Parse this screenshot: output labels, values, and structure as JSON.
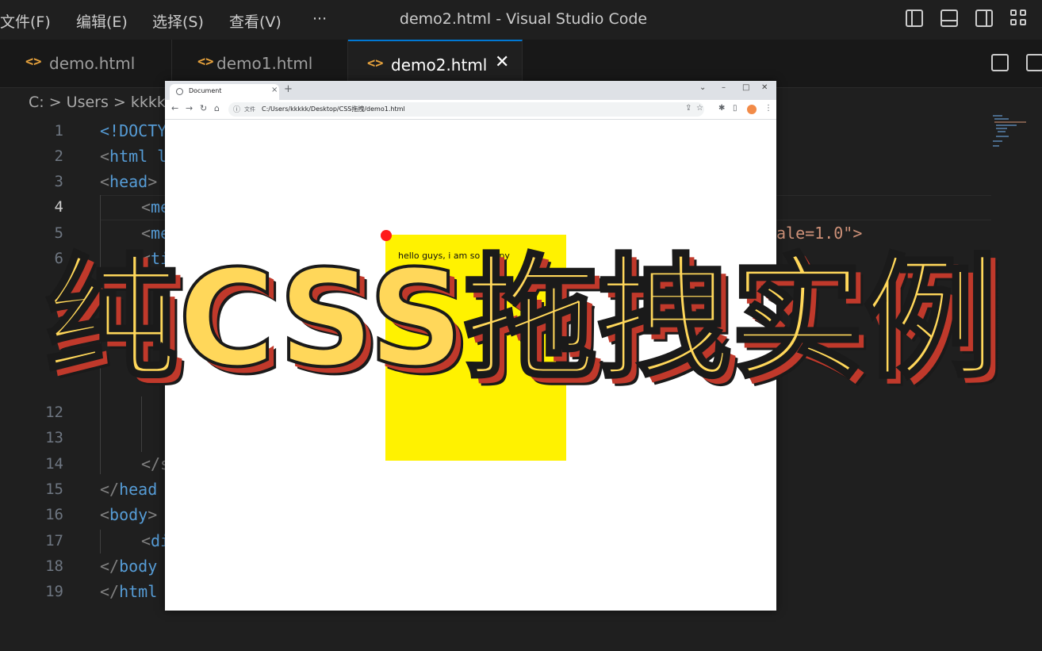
{
  "menu": [
    "文件(F)",
    "编辑(E)",
    "选择(S)",
    "查看(V)",
    "···"
  ],
  "window_title": "demo2.html - Visual Studio Code",
  "tabs": [
    {
      "icon": "<>",
      "label": "demo.html",
      "active": false
    },
    {
      "icon": "<>",
      "label": "demo1.html",
      "active": false
    },
    {
      "icon": "<>",
      "label": "demo2.html",
      "active": true,
      "close": "✕"
    }
  ],
  "breadcrumb": "C: > Users > kkkk",
  "line_numbers": [
    "1",
    "2",
    "3",
    "4",
    "5",
    "6",
    "12",
    "13",
    "14",
    "15",
    "16",
    "17",
    "18",
    "19"
  ],
  "code": {
    "l1": "<!DOCTY",
    "l2_tag": "html",
    "l2_rest": " l",
    "l3": "head",
    "l4": "me",
    "l5": "me",
    "l5_tail": "ale=1.0\">",
    "l6": "ti",
    "l14": "</s",
    "l15": "head",
    "l16": "body",
    "l17": "di",
    "l18": "body",
    "l19": "html"
  },
  "browser": {
    "tab_title": "Document",
    "tab_close": "×",
    "new_tab": "+",
    "scheme_label": "文件",
    "url": "C:/Users/kkkkk/Desktop/CSS拖拽/demo1.html",
    "box_text": "hello guys, i am so happy"
  },
  "overlay_title": "纯CSS拖拽实例",
  "colors": {
    "overlay_fill": "#ffd75a",
    "overlay_shadow": "#c0392b",
    "drag_box": "#fff200",
    "drag_handle": "#ff1a1a",
    "accent": "#0078d4"
  }
}
